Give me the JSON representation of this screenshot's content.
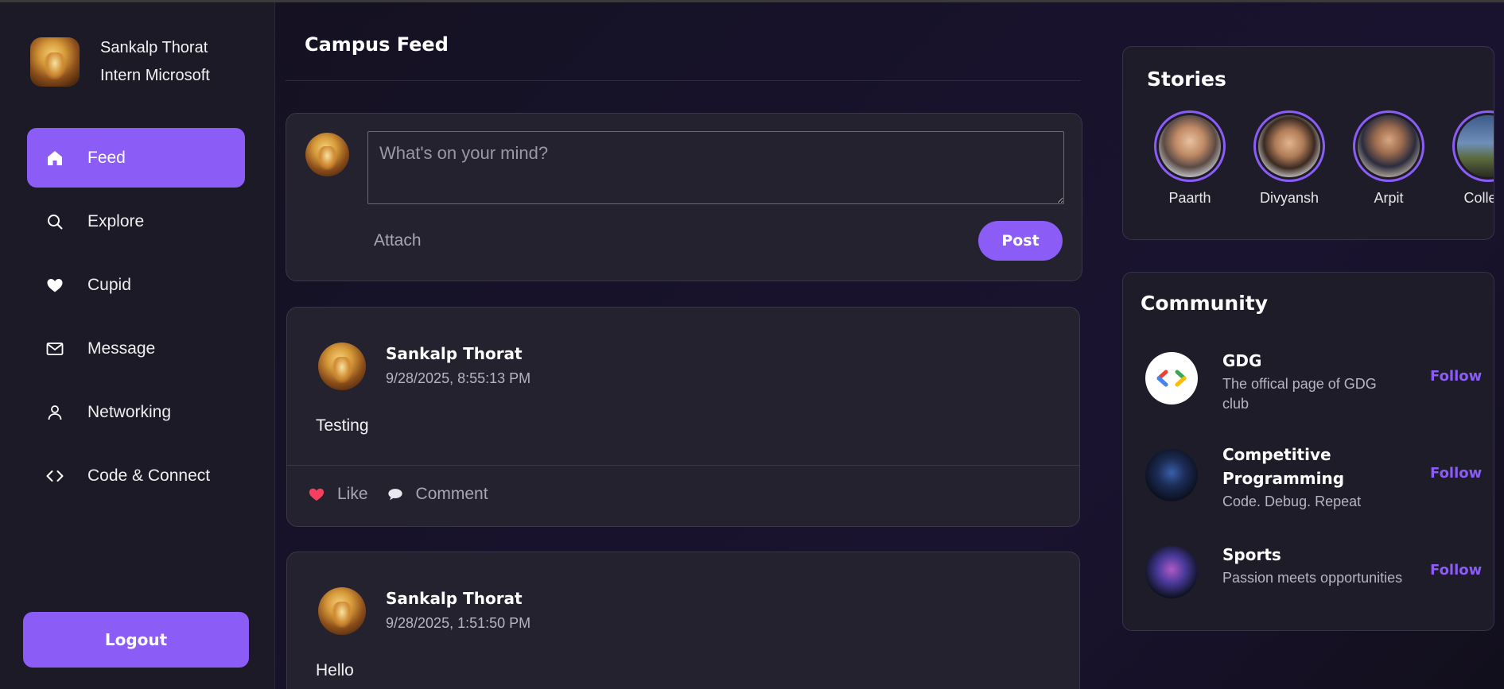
{
  "user": {
    "name": "Sankalp Thorat",
    "role": "Intern Microsoft"
  },
  "nav": [
    {
      "label": "Feed",
      "icon": "home-icon",
      "active": true
    },
    {
      "label": "Explore",
      "icon": "search-icon",
      "active": false
    },
    {
      "label": "Cupid",
      "icon": "heart-icon",
      "active": false
    },
    {
      "label": "Message",
      "icon": "mail-icon",
      "active": false
    },
    {
      "label": "Networking",
      "icon": "user-icon",
      "active": false
    },
    {
      "label": "Code & Connect",
      "icon": "code-icon",
      "active": false
    }
  ],
  "logout_label": "Logout",
  "feed": {
    "title": "Campus Feed",
    "composer": {
      "placeholder": "What's on your mind?",
      "attach_label": "Attach",
      "post_label": "Post"
    },
    "posts": [
      {
        "author": "Sankalp Thorat",
        "time": "9/28/2025, 8:55:13 PM",
        "body": "Testing",
        "like_label": "Like",
        "comment_label": "Comment"
      },
      {
        "author": "Sankalp Thorat",
        "time": "9/28/2025, 1:51:50 PM",
        "body": "Hello"
      }
    ]
  },
  "stories": {
    "title": "Stories",
    "items": [
      {
        "name": "Paarth"
      },
      {
        "name": "Divyansh"
      },
      {
        "name": "Arpit"
      },
      {
        "name": "College"
      }
    ]
  },
  "community": {
    "title": "Community",
    "items": [
      {
        "name": "GDG",
        "desc": "The offical page of GDG club",
        "follow": "Follow"
      },
      {
        "name": "Competitive Programming",
        "desc": "Code. Debug. Repeat",
        "follow": "Follow"
      },
      {
        "name": "Sports",
        "desc": "Passion meets opportunities",
        "follow": "Follow"
      }
    ]
  },
  "colors": {
    "accent": "#8b5cf6",
    "card": "#25222f",
    "sidebar": "#1c1a26",
    "like": "#f43f5e"
  }
}
